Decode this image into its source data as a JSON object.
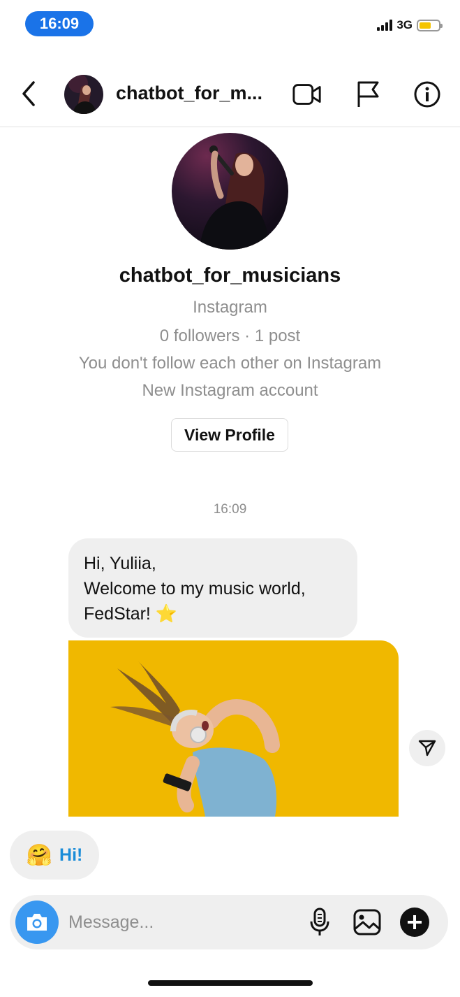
{
  "status_bar": {
    "time": "16:09",
    "network": "3G"
  },
  "header": {
    "title": "chatbot_for_m...",
    "icons": [
      "back-chevron-icon",
      "video-call-icon",
      "flag-icon",
      "info-icon"
    ]
  },
  "profile": {
    "username": "chatbot_for_musicians",
    "platform": "Instagram",
    "stats": "0 followers · 1 post",
    "follow_status": "You don't follow each other on Instagram",
    "account_note": "New Instagram account",
    "view_profile_label": "View Profile"
  },
  "conversation": {
    "timestamp": "16:09",
    "messages": [
      {
        "lines": [
          "Hi, Yuliia,",
          "Welcome to my music world,",
          "FedStar! ⭐"
        ]
      }
    ],
    "quick_reply": {
      "emoji": "🤗",
      "label": "Hi!"
    }
  },
  "composer": {
    "placeholder": "Message...",
    "icons": [
      "camera-icon",
      "microphone-icon",
      "gallery-icon",
      "plus-icon"
    ]
  },
  "colors": {
    "accent": "#3897f0",
    "time_pill": "#1a73e8",
    "link_blue": "#1a8cd8",
    "photo_bg": "#f0b800"
  }
}
